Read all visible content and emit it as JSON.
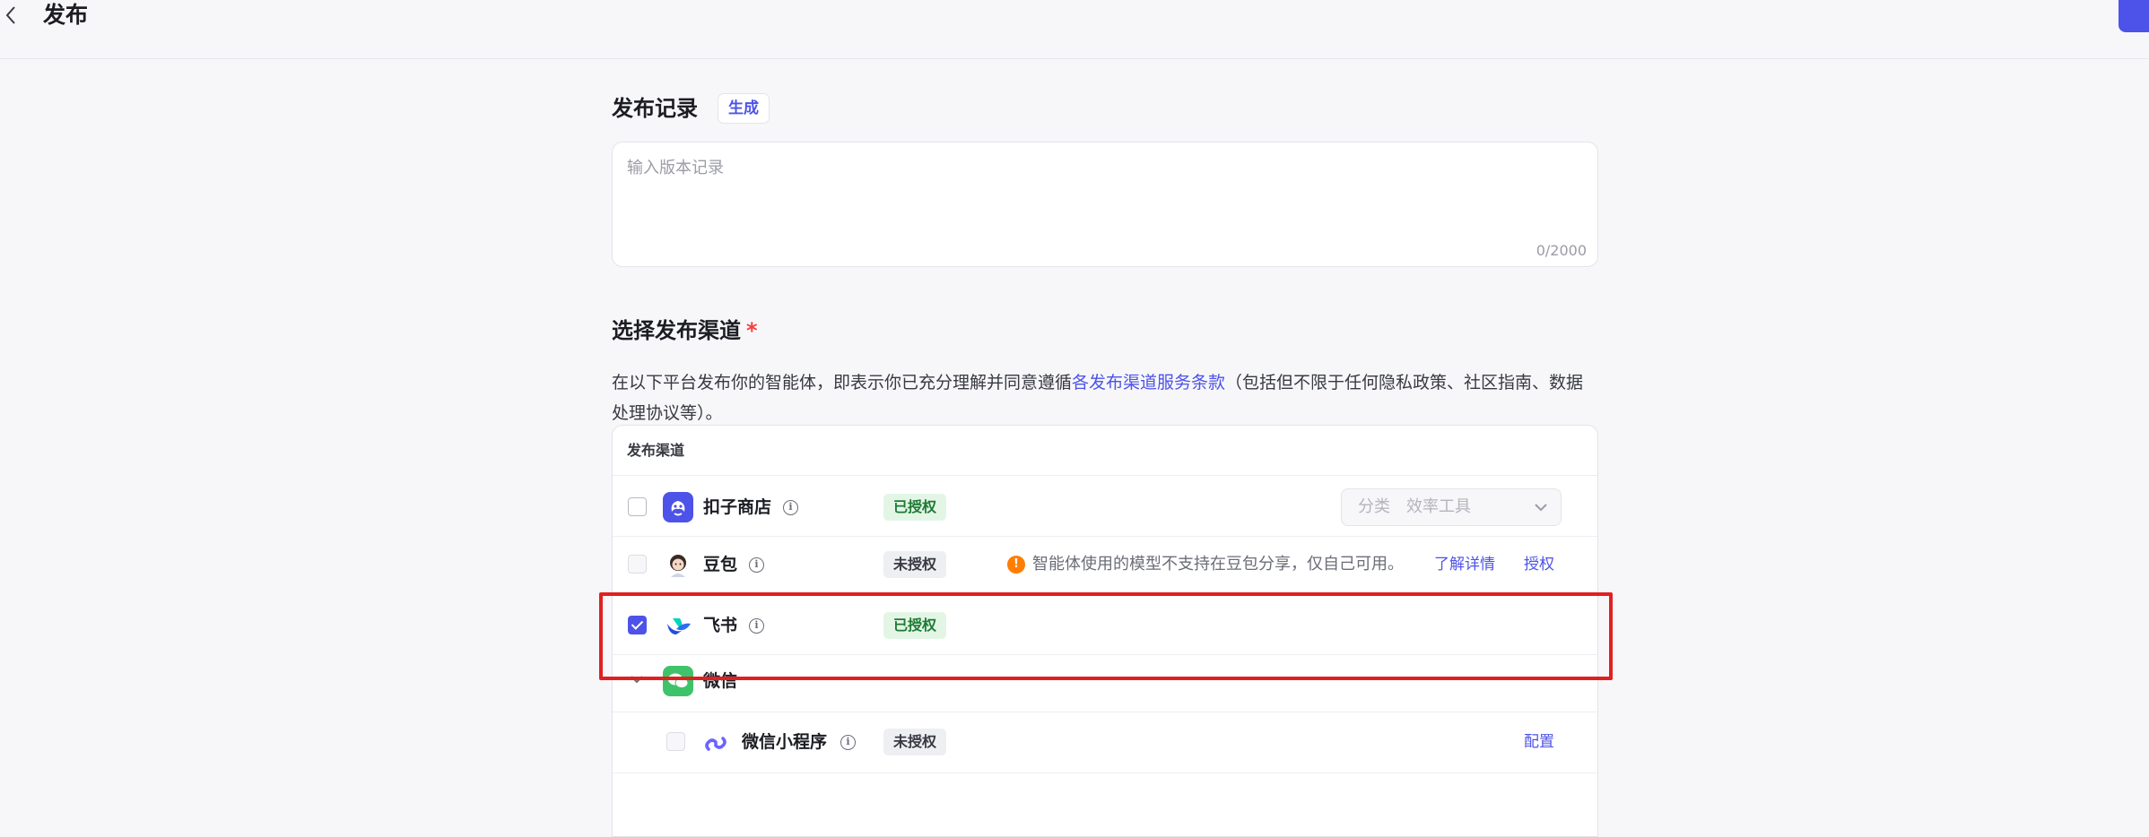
{
  "header": {
    "title": "发布"
  },
  "record": {
    "title": "发布记录",
    "generate_label": "生成",
    "placeholder": "输入版本记录",
    "counter": "0/2000"
  },
  "channels": {
    "title": "选择发布渠道",
    "required_mark": "*",
    "desc_before": "在以下平台发布你的智能体，即表示你已充分理解并同意遵循",
    "desc_link": "各发布渠道服务条款",
    "desc_after": "（包括但不限于任何隐私政策、社区指南、数据处理协议等）。",
    "table_header": "发布渠道",
    "rows": [
      {
        "name": "扣子商店",
        "status": "已授权",
        "checked": false,
        "category_label": "分类",
        "category_value": "效率工具"
      },
      {
        "name": "豆包",
        "status": "未授权",
        "checked": false,
        "disabled": true,
        "warning": "智能体使用的模型不支持在豆包分享，仅自己可用。",
        "learn_more": "了解详情",
        "action": "授权"
      },
      {
        "name": "飞书",
        "status": "已授权",
        "checked": true
      },
      {
        "name": "微信"
      },
      {
        "name": "微信小程序",
        "status": "未授权",
        "checked": false,
        "disabled": true,
        "action": "配置"
      }
    ]
  },
  "colors": {
    "accent": "#4d53e8",
    "highlight_border": "#e02020",
    "authorized_bg": "#e3f6e6",
    "warning": "#ff7d00"
  }
}
